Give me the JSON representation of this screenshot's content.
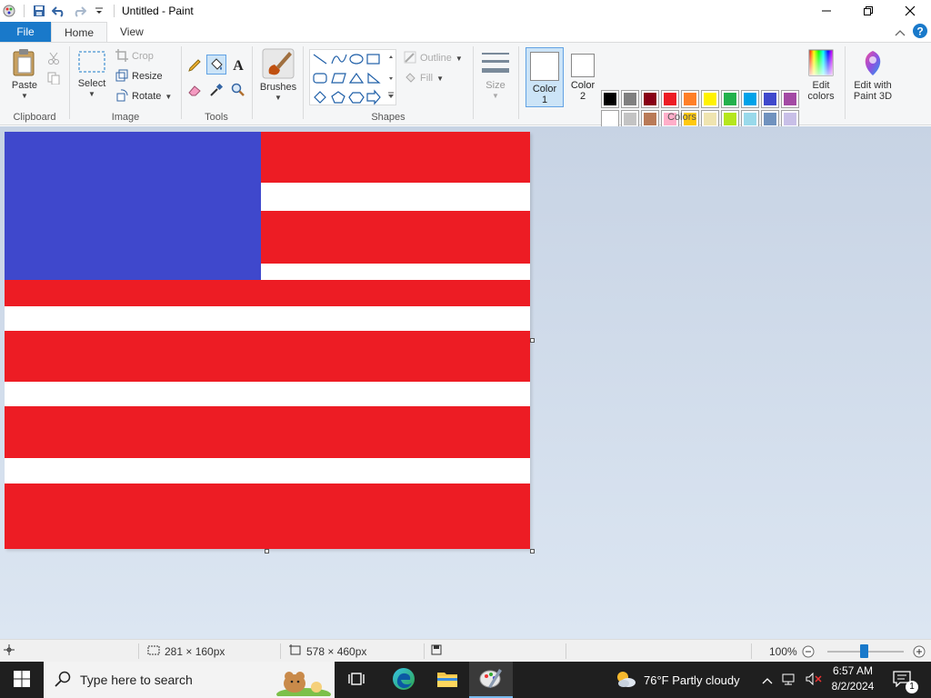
{
  "window": {
    "title": "Untitled - Paint"
  },
  "tabs": [
    {
      "label": "File"
    },
    {
      "label": "Home"
    },
    {
      "label": "View"
    }
  ],
  "ribbon": {
    "clipboard": {
      "label": "Clipboard",
      "paste": "Paste"
    },
    "image": {
      "label": "Image",
      "select": "Select",
      "crop": "Crop",
      "resize": "Resize",
      "rotate": "Rotate"
    },
    "tools": {
      "label": "Tools"
    },
    "brushes": {
      "label": "Brushes"
    },
    "shapes": {
      "label": "Shapes",
      "outline": "Outline",
      "fill": "Fill"
    },
    "size": {
      "label": "Size"
    },
    "colors": {
      "label": "Colors",
      "color1": "Color\n1",
      "color1_line1": "Color",
      "color1_line2": "1",
      "color2_line1": "Color",
      "color2_line2": "2",
      "edit_line1": "Edit",
      "edit_line2": "colors",
      "paint3d_line1": "Edit with",
      "paint3d_line2": "Paint 3D",
      "palette_row1": [
        "#000000",
        "#7f7f7f",
        "#880015",
        "#ed1c24",
        "#ff7f27",
        "#fff200",
        "#22b14c",
        "#00a2e8",
        "#3f48cc",
        "#a349a4"
      ],
      "palette_row2": [
        "#ffffff",
        "#c3c3c3",
        "#b97a57",
        "#ffaec9",
        "#ffc90e",
        "#efe4b0",
        "#b5e61d",
        "#99d9ea",
        "#7092be",
        "#c8bfe7"
      ],
      "palette_row3": [
        "#ffffff",
        "#ffffff",
        "#ffffff",
        "#ffffff",
        "#ffffff",
        "#ffffff",
        "#ffffff",
        "#ffffff",
        "#ffffff",
        "#ffffff"
      ]
    }
  },
  "flag": {
    "red": "#ed1c24",
    "white": "#ffffff",
    "blue": "#3f48cc"
  },
  "statusbar": {
    "selection_size": "281 × 160px",
    "image_size": "578 × 460px",
    "zoom": "100%"
  },
  "taskbar": {
    "search_placeholder": "Type here to search",
    "weather": "76°F  Partly cloudy",
    "time": "6:57 AM",
    "date": "8/2/2024",
    "notification_count": "1"
  }
}
